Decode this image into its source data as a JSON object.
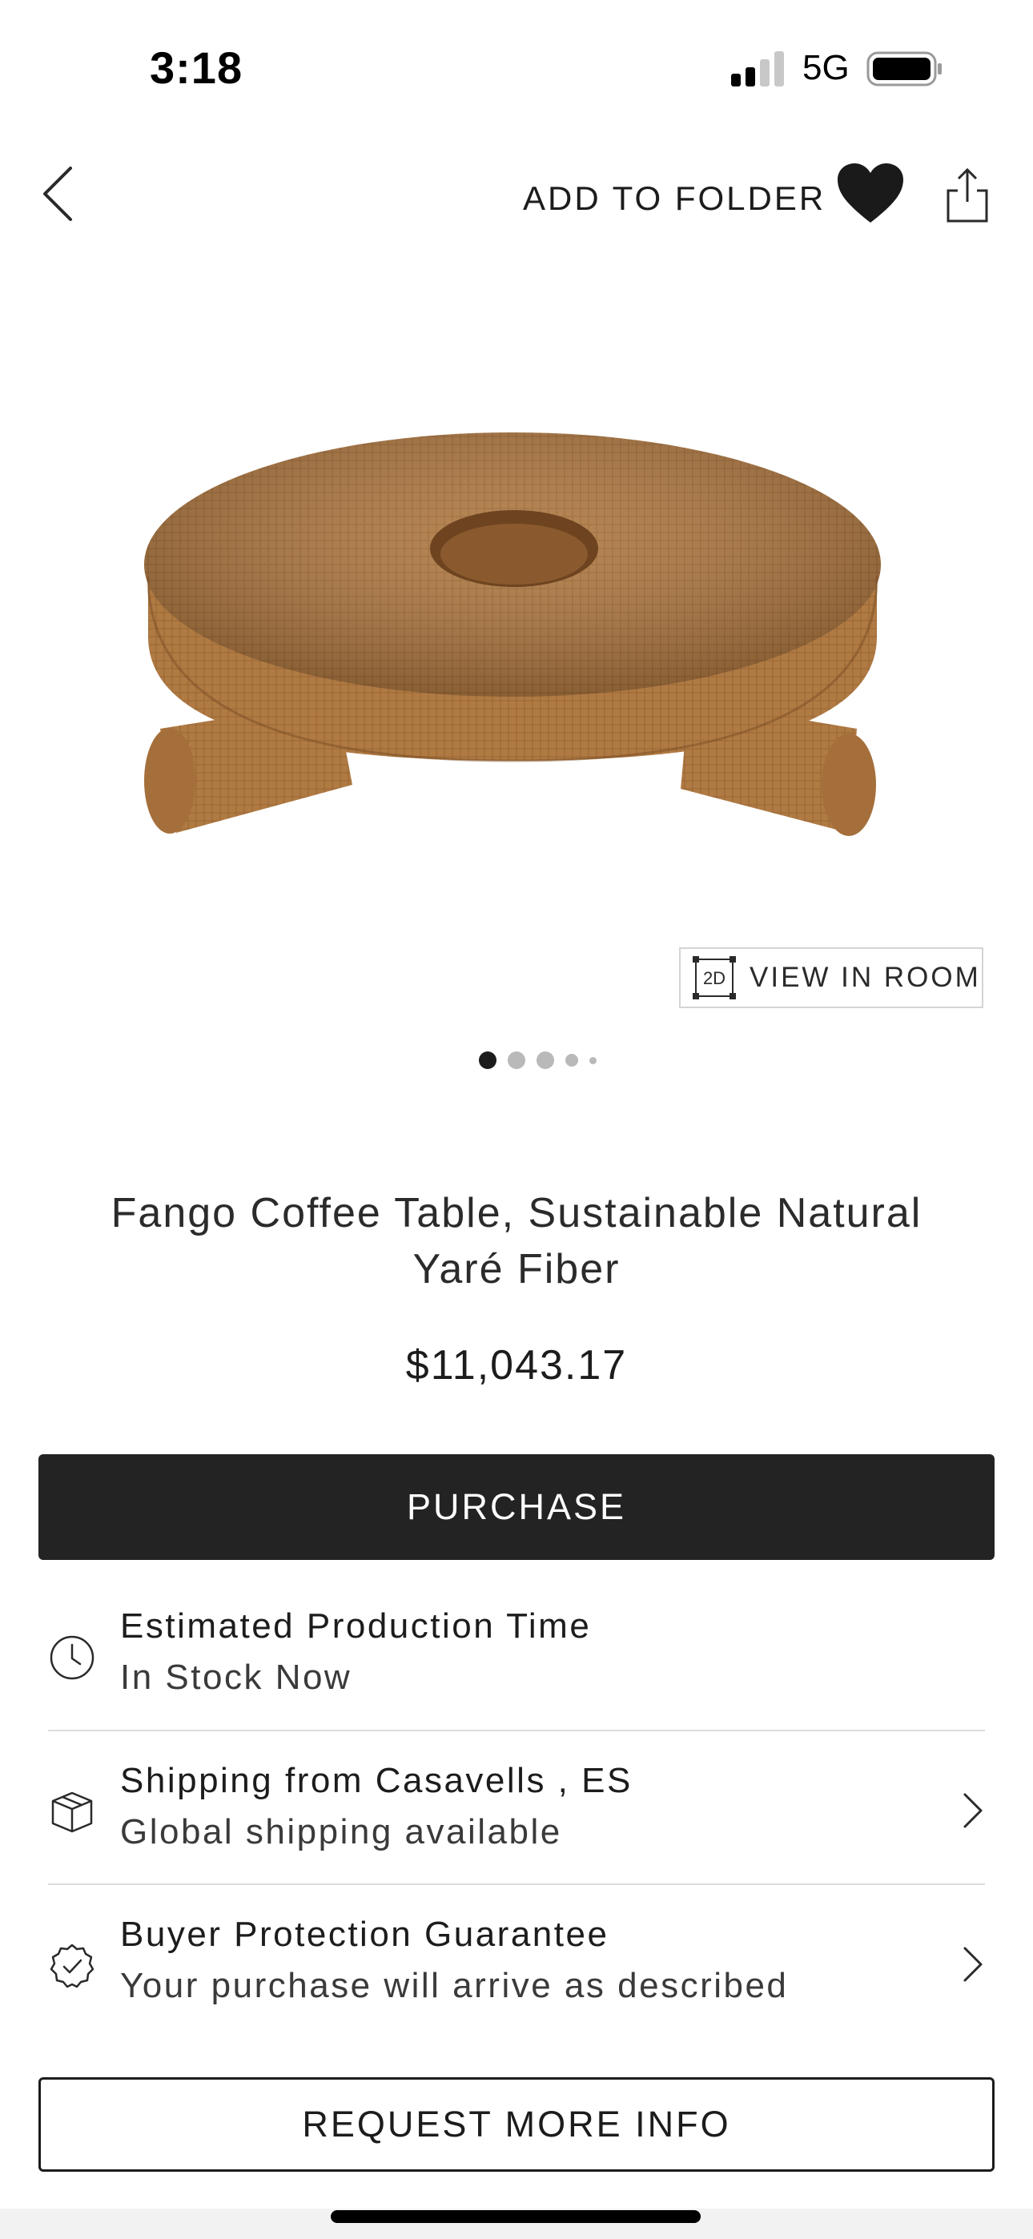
{
  "status_bar": {
    "time": "3:18",
    "network": "5G",
    "icons": [
      "signal-icon",
      "battery-icon"
    ]
  },
  "nav": {
    "add_to_folder": "ADD TO FOLDER",
    "icons": [
      "back-chevron-icon",
      "heart-icon",
      "share-icon"
    ],
    "favorited": true
  },
  "gallery": {
    "view_in_room_badge": "2D",
    "view_in_room_label": "VIEW IN ROOM",
    "page_count": 5,
    "active_page": 1
  },
  "product": {
    "title": "Fango Coffee Table, Sustainable Natural Yaré Fiber",
    "price": "$11,043.17"
  },
  "actions": {
    "purchase_label": "PURCHASE",
    "request_label": "REQUEST MORE INFO"
  },
  "info_rows": [
    {
      "icon": "clock-icon",
      "title": "Estimated Production Time",
      "subtitle": "In Stock Now",
      "has_chevron": false
    },
    {
      "icon": "box-icon",
      "title": "Shipping from Casavells , ES",
      "subtitle": "Global shipping available",
      "has_chevron": true
    },
    {
      "icon": "badge-check-icon",
      "title": "Buyer Protection Guarantee",
      "subtitle": "Your purchase will arrive as described",
      "has_chevron": true
    }
  ],
  "colors": {
    "primary_button": "#232323",
    "text": "#1c1c1c",
    "wicker": "#b07a43"
  }
}
